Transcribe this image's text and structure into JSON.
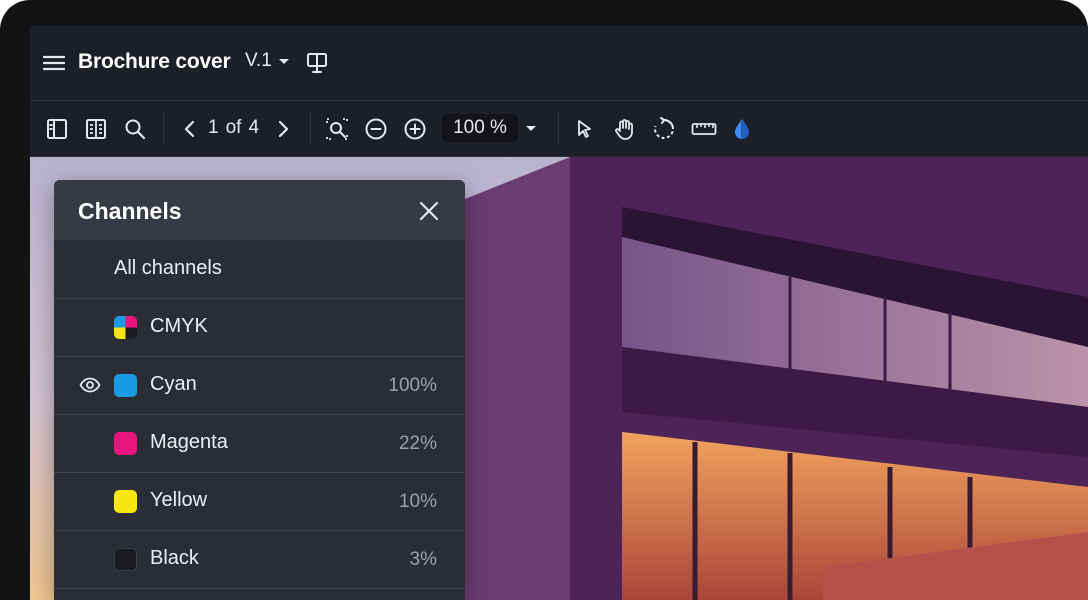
{
  "document": {
    "title": "Brochure cover",
    "version": "V.1"
  },
  "toolbar": {
    "page": {
      "current": "1",
      "of_label": "of",
      "total": "4"
    },
    "zoom": {
      "value": "100 %"
    }
  },
  "channels_panel": {
    "title": "Channels",
    "all_label": "All channels",
    "composite_label": "CMYK",
    "channels": [
      {
        "name": "Cyan",
        "percent": "100%",
        "color": "#1a9ae0",
        "visible": true
      },
      {
        "name": "Magenta",
        "percent": "22%",
        "color": "#e8157f",
        "visible": false
      },
      {
        "name": "Yellow",
        "percent": "10%",
        "color": "#f7e60f",
        "visible": false
      },
      {
        "name": "Black",
        "percent": "3%",
        "color": "#1b1c1f",
        "visible": false
      }
    ]
  },
  "icons": {
    "menu": "hamburger-icon",
    "present": "presentation-icon",
    "sidebar": "sidebar-icon",
    "thumbnails": "thumbnails-icon",
    "search": "search-icon",
    "prev": "chevron-left-icon",
    "next": "chevron-right-icon",
    "zoom_region": "zoom-region-icon",
    "zoom_out": "zoom-out-icon",
    "zoom_in": "zoom-in-icon",
    "select": "pointer-icon",
    "pan": "hand-icon",
    "rotate": "rotate-icon",
    "measure": "ruler-icon",
    "separations": "ink-drop-icon",
    "close": "close-icon",
    "eye": "eye-icon"
  },
  "colors": {
    "accent": "#3d8bff",
    "panel": "#2a2d36",
    "toolbar": "#1c1f27"
  }
}
